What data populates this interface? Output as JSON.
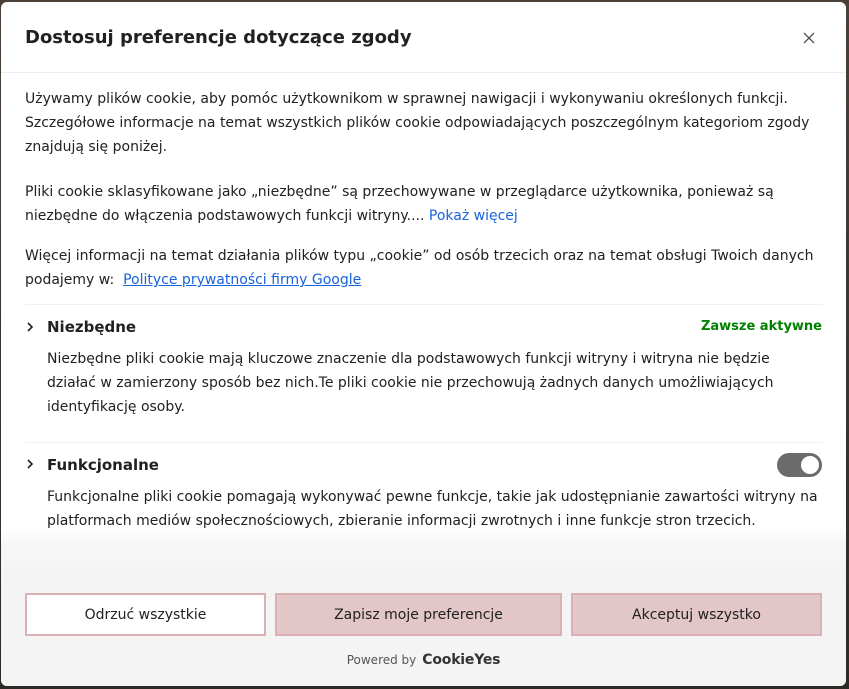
{
  "modal": {
    "title": "Dostosuj preferencje dotyczące zgody",
    "close_icon": "close-icon"
  },
  "intro": {
    "paragraph1": "Używamy plików cookie, aby pomóc użytkownikom w sprawnej nawigacji i wykonywaniu określonych funkcji. Szczegółowe informacje na temat wszystkich plików cookie odpowiadających poszczególnym kategoriom zgody znajdują się poniżej.",
    "paragraph2": "Pliki cookie sklasyfikowane jako „niezbędne” są przechowywane w przeglądarce użytkownika, ponieważ są niezbędne do włączenia podstawowych funkcji witryny....",
    "show_more": "Pokaż więcej",
    "paragraph3": "Więcej informacji na temat działania plików typu „cookie” od osób trzecich oraz na temat obsługi Twoich danych podajemy w:",
    "privacy_link": "Polityce prywatności firmy Google"
  },
  "categories": [
    {
      "title": "Niezbędne",
      "status": "Zawsze aktywne",
      "description": "Niezbędne pliki cookie mają kluczowe znaczenie dla podstawowych funkcji witryny i witryna nie będzie działać w zamierzony sposób bez nich.Te pliki cookie nie przechowują żadnych danych umożliwiających identyfikację osoby."
    },
    {
      "title": "Funkcjonalne",
      "toggle_state": "on",
      "description": "Funkcjonalne pliki cookie pomagają wykonywać pewne funkcje, takie jak udostępnianie zawartości witryny na platformach mediów społecznościowych, zbieranie informacji zwrotnych i inne funkcje stron trzecich."
    }
  ],
  "footer": {
    "reject_label": "Odrzuć wszystkie",
    "save_label": "Zapisz moje preferencje",
    "accept_label": "Akceptuj wszystko",
    "powered_by": "Powered by",
    "brand": "CookieYes"
  },
  "colors": {
    "accent_button": "#e2c6c8",
    "button_border": "#d9b0b3",
    "link": "#1863dc",
    "always_active": "#008000",
    "toggle": "#6b6b6b"
  }
}
